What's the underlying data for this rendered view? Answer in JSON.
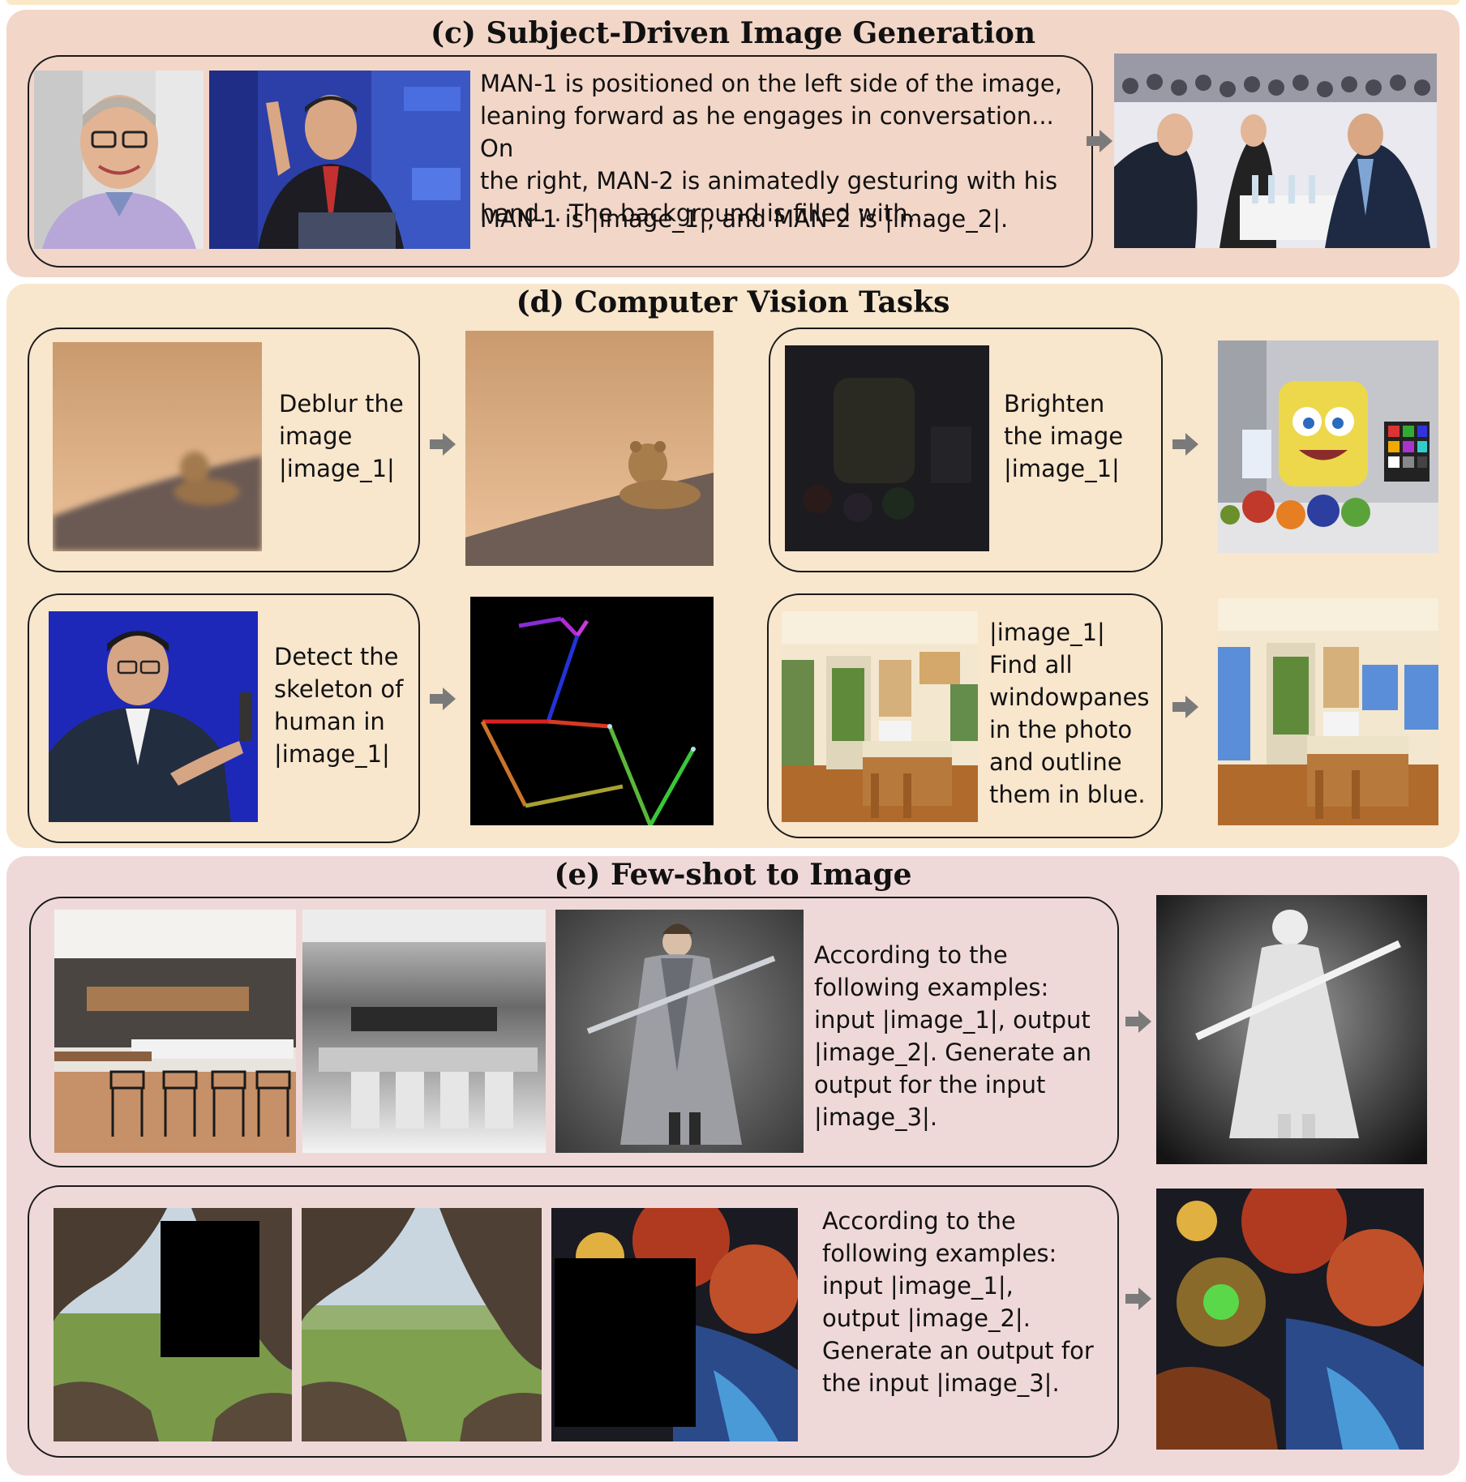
{
  "sections": {
    "c": {
      "title": "(c) Subject-Driven Image Generation",
      "prompt": "MAN-1 is positioned on the left side of the image,\nleaning forward as he engages in conversation... On\nthe right, MAN-2 is animatedly gesturing with his\nhand... The background is filled with...",
      "prompt2": "MAN-1 is |image_1|, and MAN-2 is |image_2|."
    },
    "d": {
      "title": "(d) Computer Vision Tasks",
      "tasks": [
        {
          "text": "Deblur the\nimage\n|image_1|"
        },
        {
          "text": "Brighten\nthe image\n|image_1|"
        },
        {
          "text": "Detect the\nskeleton of\nhuman in\n|image_1|"
        },
        {
          "text": "|image_1|\nFind all\nwindowpanes\nin the photo\nand outline\nthem in blue."
        }
      ]
    },
    "e": {
      "title": "(e) Few-shot to Image",
      "rows": [
        {
          "text": "According to the\nfollowing examples:\ninput |image_1|, output\n|image_2|. Generate an\noutput for the input\n|image_3|."
        },
        {
          "text": "According to the\nfollowing examples:\ninput |image_1|,\noutput |image_2|.\nGenerate an output for\nthe input |image_3|."
        }
      ]
    }
  },
  "colors": {
    "panel_c": "#f2d6c8",
    "panel_d": "#f8e6cd",
    "panel_e": "#efd9d8",
    "arrow": "#7a7a7a"
  },
  "icons": {
    "arrow": "right-arrow-icon"
  }
}
